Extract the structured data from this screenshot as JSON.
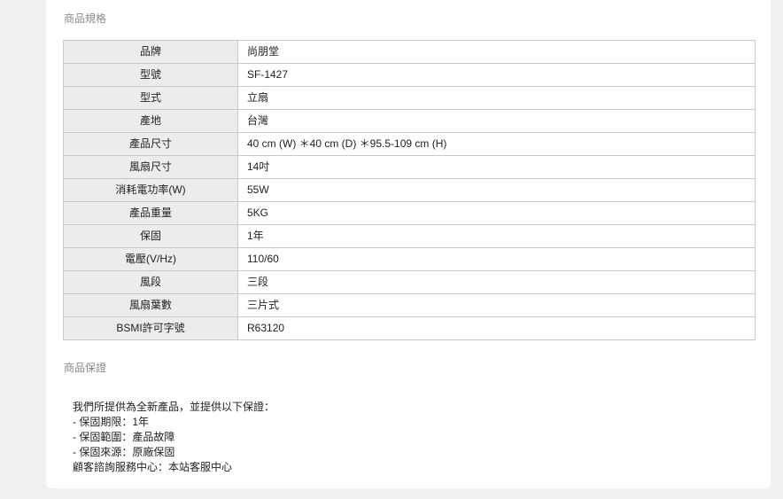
{
  "spec_section": {
    "title": "商品規格",
    "rows": [
      {
        "label": "品牌",
        "value": "尚朋堂"
      },
      {
        "label": "型號",
        "value": "SF-1427"
      },
      {
        "label": "型式",
        "value": "立扇"
      },
      {
        "label": "產地",
        "value": "台灣"
      },
      {
        "label": "產品尺寸",
        "value": "40 cm (W) ＊40 cm (D) ＊95.5-109 cm (H)"
      },
      {
        "label": "風扇尺寸",
        "value": "14吋"
      },
      {
        "label": "消耗電功率(W)",
        "value": "55W"
      },
      {
        "label": "產品重量",
        "value": "5KG"
      },
      {
        "label": "保固",
        "value": "1年"
      },
      {
        "label": "電壓(V/Hz)",
        "value": "110/60"
      },
      {
        "label": "風段",
        "value": "三段"
      },
      {
        "label": "風扇葉數",
        "value": "三片式"
      },
      {
        "label": "BSMI許可字號",
        "value": "R63120"
      }
    ]
  },
  "warranty_section": {
    "title": "商品保證",
    "lines": [
      "我們所提供為全新產品，並提供以下保證：",
      "- 保固期限：1年",
      "- 保固範圍：產品故障",
      "- 保固來源：原廠保固",
      "顧客諮詢服務中心：本站客服中心"
    ]
  }
}
